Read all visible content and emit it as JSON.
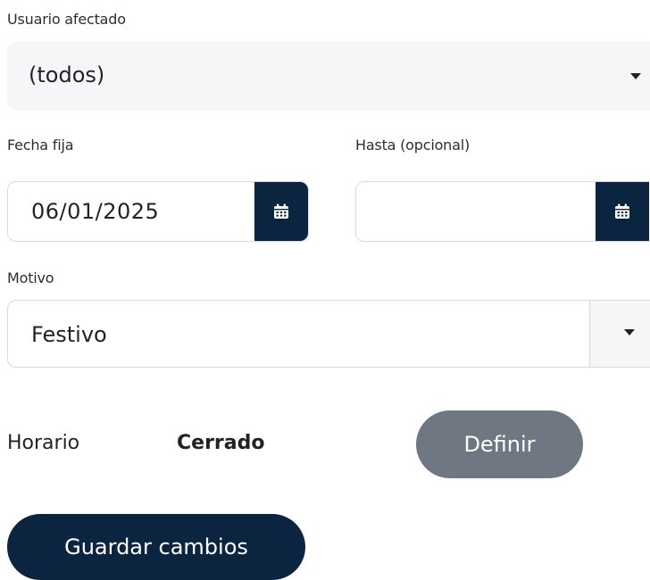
{
  "user_field": {
    "label": "Usuario afectado",
    "selected": "(todos)"
  },
  "date_from": {
    "label": "Fecha fija",
    "value": "06/01/2025"
  },
  "date_to": {
    "label": "Hasta (opcional)",
    "value": ""
  },
  "motivo": {
    "label": "Motivo",
    "selected": "Festivo"
  },
  "schedule": {
    "label": "Horario",
    "value": "Cerrado",
    "define_button": "Definir"
  },
  "actions": {
    "save_label": "Guardar cambios"
  },
  "colors": {
    "primary_dark": "#0b2540",
    "muted_button": "#6f7782",
    "field_bg": "#f5f6f8"
  },
  "icons": {
    "calendar": "calendar-icon",
    "dropdown": "caret-down-icon"
  }
}
